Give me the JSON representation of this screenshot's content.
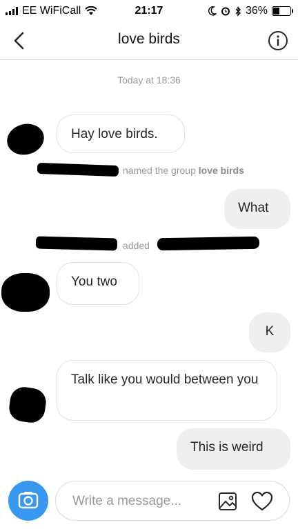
{
  "status_bar": {
    "carrier": "EE WiFiCall",
    "time": "21:17",
    "battery": "36%",
    "battery_level": 0.36
  },
  "header": {
    "title": "love birds"
  },
  "conversation": {
    "timestamp": "Today at 18:36",
    "messages": [
      {
        "direction": "incoming",
        "text": "Hay love birds."
      },
      {
        "direction": "system",
        "text": "named the group",
        "bold": "love birds"
      },
      {
        "direction": "outgoing",
        "text": "What"
      },
      {
        "direction": "system",
        "text": "added"
      },
      {
        "direction": "incoming",
        "text": "You two"
      },
      {
        "direction": "outgoing",
        "text": "K"
      },
      {
        "direction": "incoming",
        "text": "Talk like you would between you"
      },
      {
        "direction": "outgoing",
        "text": "This is weird"
      }
    ]
  },
  "composer": {
    "placeholder": "Write a message..."
  },
  "colors": {
    "accent": "#3897f0",
    "outgoing_bubble": "#efefef",
    "incoming_border": "#e3e3e3",
    "muted_text": "#999999"
  }
}
